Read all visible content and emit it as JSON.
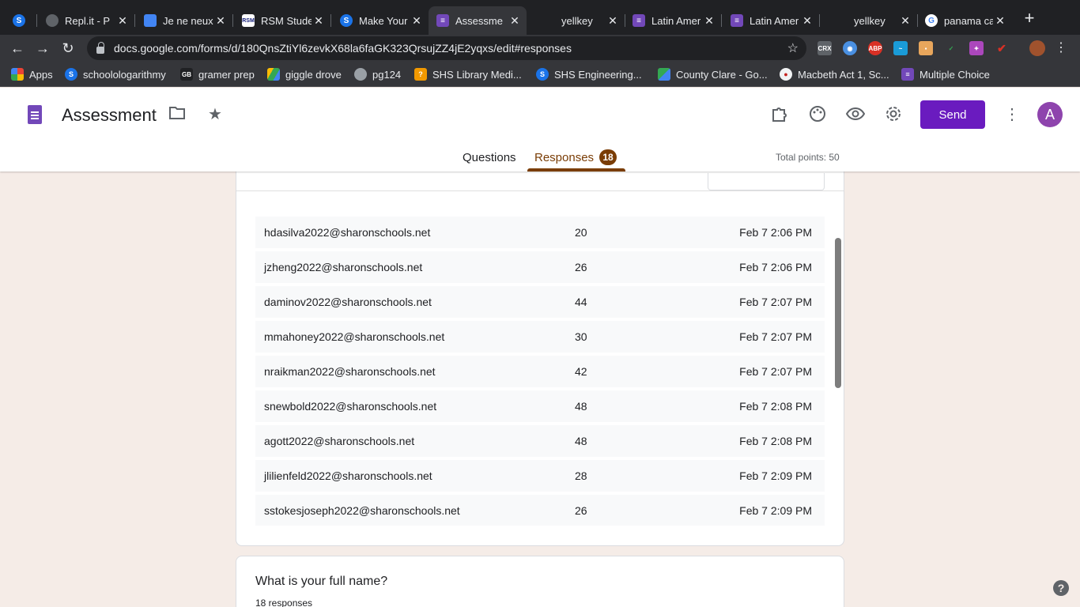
{
  "browser": {
    "tabs": [
      {
        "title": "",
        "favicon": "replit-s-icon",
        "color": "#1a73e8"
      },
      {
        "title": "Repl.it - P",
        "favicon": "replit-icon",
        "color": "#5f6368"
      },
      {
        "title": "Je ne neux",
        "favicon": "docs-icon",
        "color": "#4285f4"
      },
      {
        "title": "RSM Stude",
        "favicon": "rsm-icon",
        "color": "#ffffff"
      },
      {
        "title": "Make Your",
        "favicon": "schoology-icon",
        "color": "#1a73e8"
      },
      {
        "title": "Assessme",
        "favicon": "forms-icon",
        "color": "#7248b9"
      },
      {
        "title": "yellkey",
        "favicon": "blank-icon",
        "color": "#202124"
      },
      {
        "title": "Latin Amer",
        "favicon": "forms-icon",
        "color": "#7248b9"
      },
      {
        "title": "Latin Amer",
        "favicon": "forms-icon",
        "color": "#7248b9"
      },
      {
        "title": "yellkey",
        "favicon": "blank-icon",
        "color": "#202124"
      },
      {
        "title": "panama ca",
        "favicon": "google-icon",
        "color": "#ffffff"
      }
    ],
    "url": "docs.google.com/forms/d/180QnsZtiYl6zevkX68la6faGK323QrsujZZ4jE2yqxs/edit#responses",
    "bookmarks": [
      {
        "label": "Apps",
        "icon": "apps-grid-icon",
        "color": "#ea4335"
      },
      {
        "label": "schoolologarithmy",
        "icon": "schoology-icon",
        "color": "#1a73e8"
      },
      {
        "label": "gramer prep",
        "icon": "gbi-icon",
        "color": "#202124"
      },
      {
        "label": "giggle drove",
        "icon": "drive-icon",
        "color": "#34a853"
      },
      {
        "label": "pg124",
        "icon": "globe-icon",
        "color": "#5f6368"
      },
      {
        "label": "SHS Library Medi...",
        "icon": "library-icon",
        "color": "#f29900"
      },
      {
        "label": "SHS Engineering...",
        "icon": "schoology-icon",
        "color": "#1a73e8"
      },
      {
        "label": "County Clare - Go...",
        "icon": "maps-icon",
        "color": "#34a853"
      },
      {
        "label": "Macbeth Act 1, Sc...",
        "icon": "bookmark-icon",
        "color": "#c5221f"
      },
      {
        "label": "Multiple Choice",
        "icon": "forms-icon",
        "color": "#7248b9"
      }
    ]
  },
  "header": {
    "title": "Assessment",
    "send_label": "Send",
    "avatar_letter": "A",
    "tabs": {
      "questions": "Questions",
      "responses": "Responses",
      "responses_count": "18"
    },
    "total_points": "Total points: 50",
    "accent_color": "#7a3d06",
    "send_color": "#6a1bbf"
  },
  "responses": [
    {
      "email": "hdasilva2022@sharonschools.net",
      "score": "20",
      "time": "Feb 7 2:06 PM"
    },
    {
      "email": "jzheng2022@sharonschools.net",
      "score": "26",
      "time": "Feb 7 2:06 PM"
    },
    {
      "email": "daminov2022@sharonschools.net",
      "score": "44",
      "time": "Feb 7 2:07 PM"
    },
    {
      "email": "mmahoney2022@sharonschools.net",
      "score": "30",
      "time": "Feb 7 2:07 PM"
    },
    {
      "email": "nraikman2022@sharonschools.net",
      "score": "42",
      "time": "Feb 7 2:07 PM"
    },
    {
      "email": "snewbold2022@sharonschools.net",
      "score": "48",
      "time": "Feb 7 2:08 PM"
    },
    {
      "email": "agott2022@sharonschools.net",
      "score": "48",
      "time": "Feb 7 2:08 PM"
    },
    {
      "email": "jlilienfeld2022@sharonschools.net",
      "score": "28",
      "time": "Feb 7 2:09 PM"
    },
    {
      "email": "sstokesjoseph2022@sharonschools.net",
      "score": "26",
      "time": "Feb 7 2:09 PM"
    }
  ],
  "question": {
    "title": "What is your full name?",
    "count": "18 responses"
  }
}
